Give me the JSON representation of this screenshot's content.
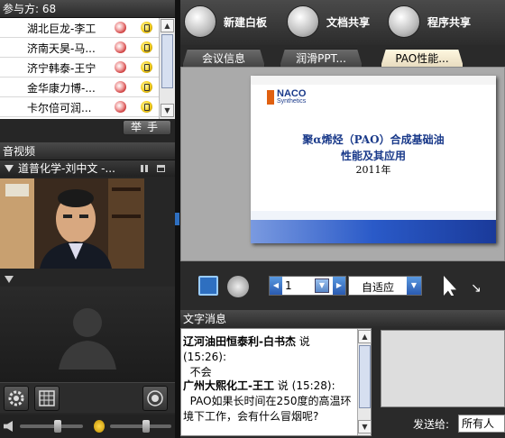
{
  "participants": {
    "header": "参与方: 68",
    "rows": [
      {
        "name": "湖北巨龙-李工"
      },
      {
        "name": "济南天昊-马..."
      },
      {
        "name": "济宁韩泰-王宁"
      },
      {
        "name": "金华康力博-..."
      },
      {
        "name": "卡尔倍可润..."
      }
    ],
    "raise_hand": "举手"
  },
  "av": {
    "header": "音视频",
    "video_label": "道普化学-刘中文 -..."
  },
  "toolbar": {
    "new_whiteboard": "新建白板",
    "doc_share": "文档共享",
    "app_share": "程序共享"
  },
  "tabs": [
    {
      "label": "会议信息",
      "active": false
    },
    {
      "label": "润滑PPT...",
      "active": false
    },
    {
      "label": "PAO性能...",
      "active": true
    }
  ],
  "slide": {
    "logo_top": "NACO",
    "logo_bottom": "Synthetics",
    "title_line1": "聚α烯烃（PAO）合成基础油",
    "title_line2": "性能及其应用",
    "year": "2011年"
  },
  "controls": {
    "page": "1",
    "fit_mode": "自适应"
  },
  "chat": {
    "header": "文字消息",
    "messages": [
      {
        "sender": "辽河油田恒泰利-白书杰",
        "said": " 说",
        "time": "(15:26):",
        "text": "不会"
      },
      {
        "sender": "广州大熙化工-王工",
        "said": " 说",
        "time": "(15:28):",
        "text": "PAO如果长时间在250度的高温环境下工作，会有什么冒烟呢?"
      }
    ],
    "send_to_label": "发送给:",
    "send_to_value": "所有人"
  },
  "colors": {
    "accent_blue": "#2e6fc0",
    "slide_title": "#1a3a8a"
  }
}
